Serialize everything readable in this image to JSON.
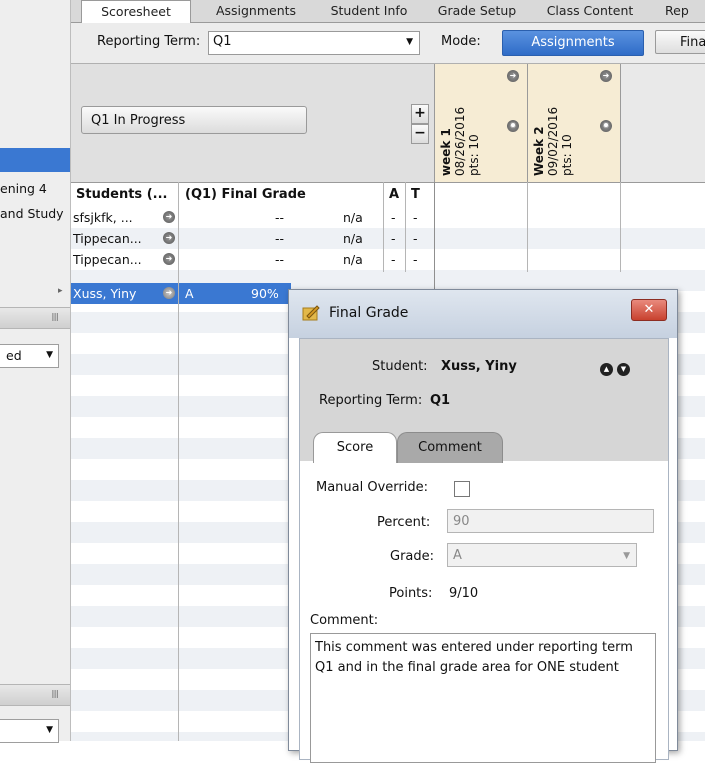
{
  "tabs": [
    {
      "label": "Scoresheet",
      "active": true
    },
    {
      "label": "Assignments",
      "active": false
    },
    {
      "label": "Student Info",
      "active": false
    },
    {
      "label": "Grade Setup",
      "active": false
    },
    {
      "label": "Class Content",
      "active": false
    },
    {
      "label": "Rep",
      "active": false
    }
  ],
  "toolbar": {
    "reporting_term_label": "Reporting Term:",
    "reporting_term_value": "Q1",
    "mode_label": "Mode:",
    "mode_active": "Assignments",
    "mode_other": "Fina"
  },
  "sidebar": {
    "item1": "ening 4",
    "item2": "and Study",
    "dropdown1": "ed",
    "grip": "III"
  },
  "grid": {
    "progress_button": "Q1 In Progress",
    "plus": "+",
    "minus": "−",
    "weeks": [
      {
        "name": "week 1",
        "date": "08/26/2016",
        "pts": "pts: 10"
      },
      {
        "name": "Week 2",
        "date": "09/02/2016",
        "pts": "pts: 10"
      }
    ],
    "headers": {
      "students": "Students (...",
      "final_grade": "(Q1) Final Grade",
      "a": "A",
      "t": "T"
    },
    "rows": [
      {
        "name": "sfsjkfk, ...",
        "grade": "--",
        "percent": "n/a",
        "a": "-",
        "t": "-"
      },
      {
        "name": "Tippecan...",
        "grade": "--",
        "percent": "n/a",
        "a": "-",
        "t": "-"
      },
      {
        "name": "Tippecan...",
        "grade": "--",
        "percent": "n/a",
        "a": "-",
        "t": "-"
      },
      {
        "name": "Xuss, Yiny",
        "grade": "A",
        "percent": "90%",
        "a": "",
        "t": ""
      }
    ]
  },
  "dialog": {
    "title": "Final Grade",
    "close": "✕",
    "student_label": "Student:",
    "student_value": "Xuss, Yiny",
    "term_label": "Reporting Term:",
    "term_value": "Q1",
    "tab_score": "Score",
    "tab_comment": "Comment",
    "manual_override_label": "Manual Override:",
    "percent_label": "Percent:",
    "percent_value": "90",
    "grade_label": "Grade:",
    "grade_value": "A",
    "points_label": "Points:",
    "points_value": "9/10",
    "comment_label": "Comment:",
    "comment_text": "This comment was entered under reporting term Q1 and in the final grade area for ONE student"
  },
  "colors": {
    "accent": "#3a78d2",
    "week_bg": "#f6ecd4",
    "close": "#c8412e"
  }
}
